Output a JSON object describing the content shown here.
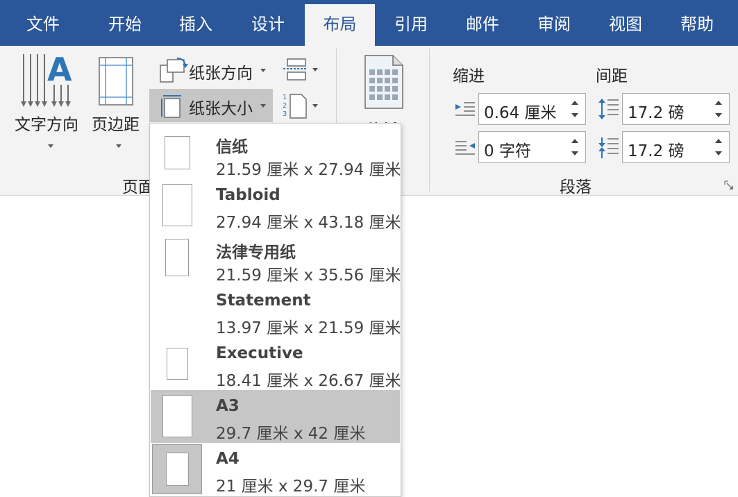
{
  "tabs": [
    {
      "label": "文件"
    },
    {
      "label": "开始"
    },
    {
      "label": "插入"
    },
    {
      "label": "设计"
    },
    {
      "label": "布局"
    },
    {
      "label": "引用"
    },
    {
      "label": "邮件"
    },
    {
      "label": "审阅"
    },
    {
      "label": "视图"
    },
    {
      "label": "帮助"
    }
  ],
  "active_tab": "布局",
  "ribbon": {
    "text_direction": {
      "label": "文字方向",
      "icon": "text-direction-icon"
    },
    "margins": {
      "label": "页边距",
      "icon": "margins-icon"
    },
    "orientation": {
      "label": "纸张方向",
      "icon": "orientation-icon"
    },
    "size": {
      "label": "纸张大小",
      "icon": "paper-size-icon"
    },
    "columns": {
      "icon": "columns-icon"
    },
    "line_numbers": {
      "icon": "line-numbers-icon"
    },
    "breaks": {
      "icon": "breaks-icon"
    },
    "manuscript": {
      "label": "稿纸",
      "icon": "manuscript-icon"
    },
    "group_page_setup": "页面",
    "indent": {
      "title": "缩进",
      "left_value": "0.64 厘米",
      "right_value": "0 字符"
    },
    "spacing": {
      "title": "间距",
      "before_value": "17.2 磅",
      "after_value": "17.2 磅"
    },
    "group_paragraph": "段落"
  },
  "paper_sizes": [
    {
      "name": "信纸",
      "dims": "21.59 厘米 x 27.94 厘米"
    },
    {
      "name": "Tabloid",
      "dims": "27.94 厘米 x 43.18 厘米"
    },
    {
      "name": "法律专用纸",
      "dims": "21.59 厘米 x 35.56 厘米"
    },
    {
      "name": "Statement",
      "dims": "13.97 厘米 x 21.59 厘米"
    },
    {
      "name": "Executive",
      "dims": "18.41 厘米 x 26.67 厘米"
    },
    {
      "name": "A3",
      "dims": "29.7 厘米 x 42 厘米"
    },
    {
      "name": "A4",
      "dims": "21 厘米 x 29.7 厘米"
    }
  ],
  "highlighted_size": "A3",
  "current_size": "A4",
  "colors": {
    "accent": "#2b579a",
    "ribbon": "#f3f3f3",
    "highlight": "#c6c6c6"
  }
}
